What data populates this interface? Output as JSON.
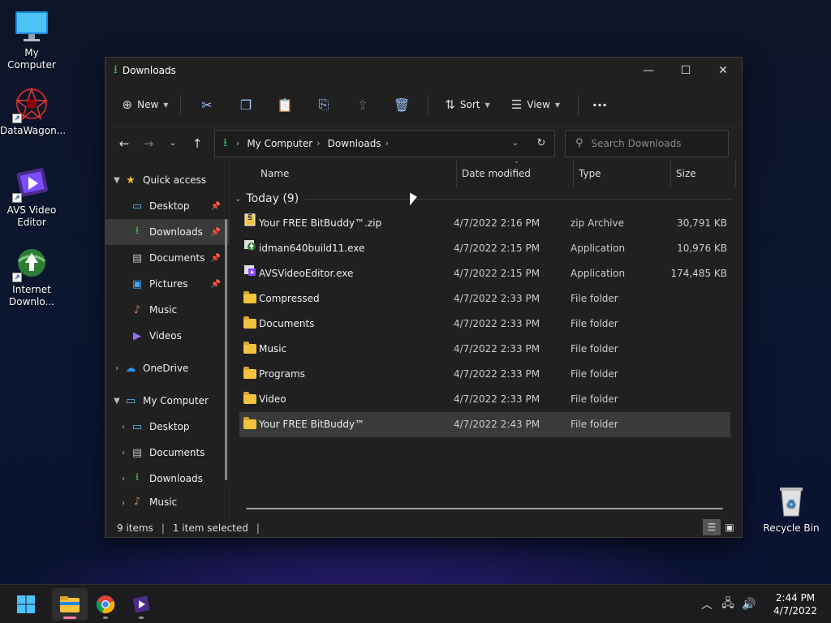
{
  "desktop": {
    "icons": [
      {
        "label": "My Computer",
        "icon": "monitor-icon"
      },
      {
        "label": "DataWagon...",
        "icon": "datawagon-icon"
      },
      {
        "label": "AVS Video Editor",
        "icon": "avs-video-editor-icon"
      },
      {
        "label": "Internet Downlo...",
        "icon": "internet-download-manager-icon"
      },
      {
        "label": "Recycle Bin",
        "icon": "recycle-bin-icon"
      }
    ]
  },
  "window": {
    "title": "Downloads",
    "controls": {
      "minimize": "—",
      "maximize": "☐",
      "close": "✕"
    }
  },
  "toolbar": {
    "new_label": "New",
    "sort_label": "Sort",
    "view_label": "View",
    "more_label": "···"
  },
  "address": {
    "crumbs": [
      "My Computer",
      "Downloads"
    ],
    "search_placeholder": "Search Downloads"
  },
  "sidebar": {
    "quick_access": "Quick access",
    "quick_items": [
      {
        "label": "Desktop",
        "icon": "desktop-icon",
        "pinned": true
      },
      {
        "label": "Downloads",
        "icon": "downloads-icon",
        "pinned": true,
        "selected": true
      },
      {
        "label": "Documents",
        "icon": "documents-icon",
        "pinned": true
      },
      {
        "label": "Pictures",
        "icon": "pictures-icon",
        "pinned": true
      },
      {
        "label": "Music",
        "icon": "music-icon"
      },
      {
        "label": "Videos",
        "icon": "videos-icon"
      }
    ],
    "onedrive": "OneDrive",
    "my_computer": "My Computer",
    "computer_items": [
      "Desktop",
      "Documents",
      "Downloads",
      "Music"
    ]
  },
  "columns": {
    "name": "Name",
    "date": "Date modified",
    "type": "Type",
    "size": "Size"
  },
  "group": {
    "label": "Today (9)"
  },
  "files": [
    {
      "name": "Your FREE BitBuddy™.zip",
      "date": "4/7/2022 2:16 PM",
      "type": "zip Archive",
      "size": "30,791 KB",
      "icon": "zip-icon"
    },
    {
      "name": "idman640build11.exe",
      "date": "4/7/2022 2:15 PM",
      "type": "Application",
      "size": "10,976 KB",
      "icon": "exe-icon"
    },
    {
      "name": "AVSVideoEditor.exe",
      "date": "4/7/2022 2:15 PM",
      "type": "Application",
      "size": "174,485 KB",
      "icon": "exe-icon"
    },
    {
      "name": "Compressed",
      "date": "4/7/2022 2:33 PM",
      "type": "File folder",
      "size": "",
      "icon": "folder-icon"
    },
    {
      "name": "Documents",
      "date": "4/7/2022 2:33 PM",
      "type": "File folder",
      "size": "",
      "icon": "folder-icon"
    },
    {
      "name": "Music",
      "date": "4/7/2022 2:33 PM",
      "type": "File folder",
      "size": "",
      "icon": "folder-icon"
    },
    {
      "name": "Programs",
      "date": "4/7/2022 2:33 PM",
      "type": "File folder",
      "size": "",
      "icon": "folder-icon"
    },
    {
      "name": "Video",
      "date": "4/7/2022 2:33 PM",
      "type": "File folder",
      "size": "",
      "icon": "folder-icon"
    },
    {
      "name": "Your FREE BitBuddy™",
      "date": "4/7/2022 2:43 PM",
      "type": "File folder",
      "size": "",
      "icon": "folder-icon",
      "selected": true
    }
  ],
  "status": {
    "items": "9 items",
    "selected": "1 item selected"
  },
  "taskbar": {
    "apps": [
      "start-icon",
      "file-explorer-icon",
      "chrome-icon",
      "avs-video-editor-icon"
    ],
    "time": "2:44 PM",
    "date": "4/7/2022"
  },
  "colors": {
    "accent_green": "#3fb950",
    "folder": "#f3c33e",
    "selection": "#3a3a3a"
  }
}
